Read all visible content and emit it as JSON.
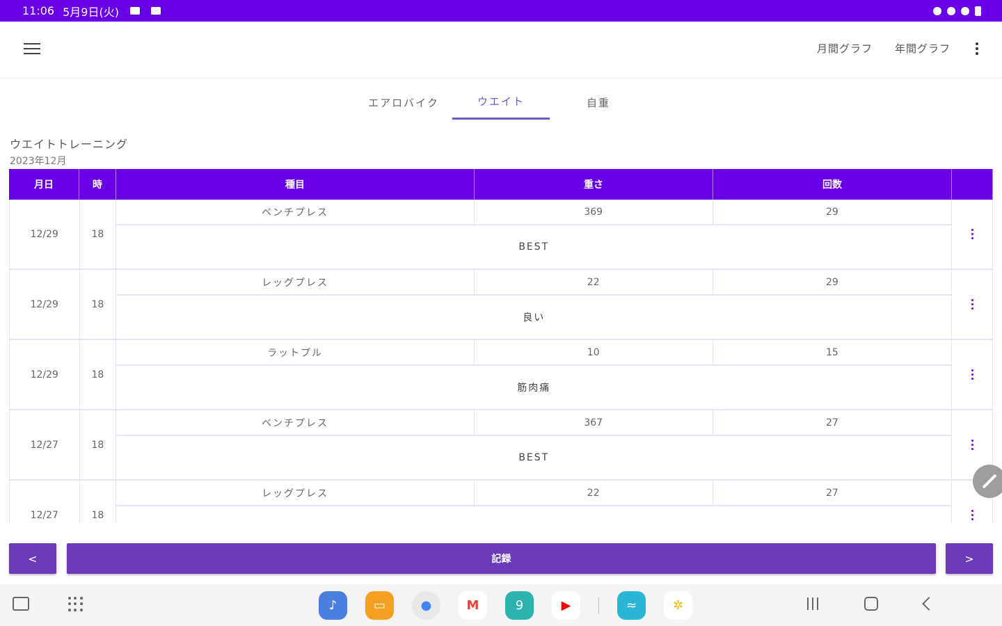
{
  "status_bar": {
    "time": "11:06",
    "date": "5月9日(火)"
  },
  "app_bar": {
    "actions": [
      "月間グラフ",
      "年間グラフ"
    ]
  },
  "tabs": [
    {
      "label": "エアロバイク",
      "active": false
    },
    {
      "label": "ウエイト",
      "active": true
    },
    {
      "label": "自重",
      "active": false
    }
  ],
  "section": {
    "title": "ウエイトトレーニング",
    "subtitle": "2023年12月"
  },
  "table": {
    "headers": {
      "date": "月日",
      "hour": "時",
      "exercise": "種目",
      "weight": "重さ",
      "reps": "回数"
    },
    "rows": [
      {
        "date": "12/29",
        "hour": "18",
        "exercise": "ベンチプレス",
        "weight": "369",
        "reps": "29",
        "note": "BEST"
      },
      {
        "date": "12/29",
        "hour": "18",
        "exercise": "レッグプレス",
        "weight": "22",
        "reps": "29",
        "note": "良い"
      },
      {
        "date": "12/29",
        "hour": "18",
        "exercise": "ラットプル",
        "weight": "10",
        "reps": "15",
        "note": "筋肉痛"
      },
      {
        "date": "12/27",
        "hour": "18",
        "exercise": "ベンチプレス",
        "weight": "367",
        "reps": "27",
        "note": "BEST"
      },
      {
        "date": "12/27",
        "hour": "18",
        "exercise": "レッグプレス",
        "weight": "22",
        "reps": "27",
        "note": ""
      }
    ]
  },
  "buttons": {
    "prev": "<",
    "record": "記録",
    "next": ">"
  },
  "colors": {
    "primary": "#6a00e8",
    "button": "#6a3ab8",
    "tab_active": "#6a5acd"
  },
  "dock_apps": [
    {
      "name": "music",
      "color": "#4a7fe0",
      "glyph": "♪"
    },
    {
      "name": "files",
      "color": "#f5a020",
      "glyph": "▭"
    },
    {
      "name": "chrome",
      "color": "#e0e0e0",
      "glyph": "●"
    },
    {
      "name": "gmail",
      "color": "#ffffff",
      "glyph": "M"
    },
    {
      "name": "calendar",
      "color": "#2bb3b0",
      "glyph": "9"
    },
    {
      "name": "youtube",
      "color": "#ffffff",
      "glyph": "▶"
    },
    {
      "name": "prime-video",
      "color": "#29b6d6",
      "glyph": "≈"
    },
    {
      "name": "photos",
      "color": "#ffffff",
      "glyph": "✲"
    }
  ]
}
